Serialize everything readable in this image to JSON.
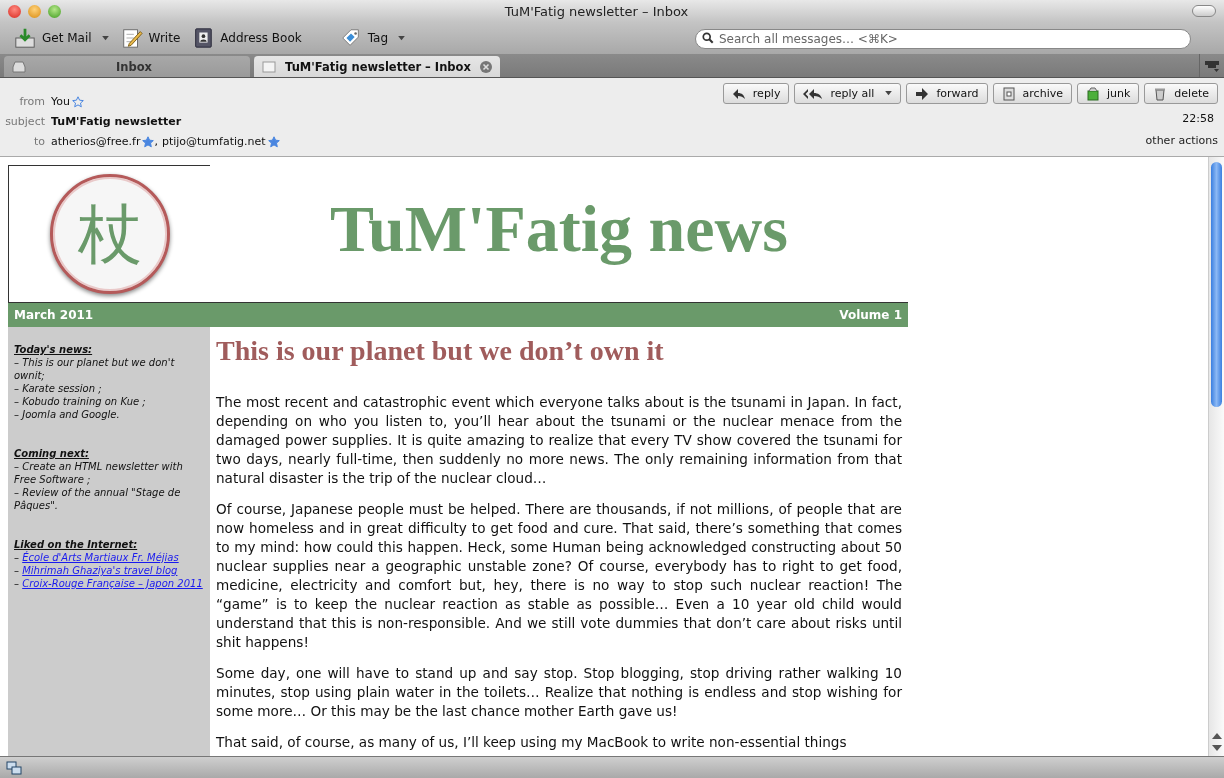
{
  "window": {
    "title": "TuM'Fatig newsletter – Inbox"
  },
  "toolbar": {
    "buttons": [
      {
        "label": "Get Mail",
        "menu": true
      },
      {
        "label": "Write",
        "menu": false
      },
      {
        "label": "Address Book",
        "menu": false
      },
      {
        "label": "Tag",
        "menu": true
      }
    ],
    "search": {
      "placeholder": "Search all messages… <⌘K>"
    }
  },
  "tabs": [
    {
      "label": "Inbox",
      "selected": false,
      "closable": false
    },
    {
      "label": "TuM'Fatig newsletter – Inbox",
      "selected": true,
      "closable": true
    }
  ],
  "header": {
    "from": {
      "label": "from",
      "people": [
        {
          "name": "You",
          "starred": false
        }
      ]
    },
    "subject": {
      "label": "subject",
      "value": "TuM'Fatig newsletter"
    },
    "to": {
      "label": "to",
      "separator": ",",
      "people": [
        {
          "name": "atherios@free.fr",
          "starred": true
        },
        {
          "name": "ptijo@tumfatig.net",
          "starred": true
        }
      ]
    },
    "time": "22:58",
    "other_actions": "other actions",
    "actions": [
      {
        "label": "reply",
        "menu": false
      },
      {
        "label": "reply all",
        "menu": true
      },
      {
        "label": "forward",
        "menu": false
      },
      {
        "label": "archive",
        "menu": false
      },
      {
        "label": "junk",
        "menu": false
      },
      {
        "label": "delete",
        "menu": false
      }
    ]
  },
  "newsletter": {
    "logo": "杖",
    "title": "TuM'Fatig news",
    "date": "March 2011",
    "volume": "Volume 1",
    "sidebar": [
      {
        "heading": "Today's news:",
        "items": [
          {
            "kind": "text",
            "text": "– This is our planet but we don't ownit;"
          },
          {
            "kind": "text",
            "text": "– Karate session ;"
          },
          {
            "kind": "text",
            "text": "– Kobudo training on Kue ;"
          },
          {
            "kind": "text",
            "text": "– Joomla and Google."
          }
        ]
      },
      {
        "heading": "Coming next:",
        "items": [
          {
            "kind": "text",
            "text": "– Create an HTML newsletter with Free Software ;"
          },
          {
            "kind": "text",
            "text": "– Review of the annual \"Stage de Pâques\"."
          }
        ]
      },
      {
        "heading": "Liked on the Internet:",
        "items": [
          {
            "kind": "link",
            "prefix": "– ",
            "text": "École d'Arts Martiaux Fr. Méjias"
          },
          {
            "kind": "link",
            "prefix": "– ",
            "text": "Mihrimah Ghaziya's travel blog"
          },
          {
            "kind": "link",
            "prefix": "– ",
            "text": "Croix-Rouge Française – Japon 2011"
          }
        ]
      }
    ],
    "article_title": "This is our planet but we don’t own it",
    "paragraphs": [
      "The most recent and catastrophic event which everyone talks about is the tsunami in Japan. In fact, depending on who you listen to, you’ll hear about the tsunami or the nuclear menace from the damaged power supplies. It is quite amazing to realize that every TV show covered the tsunami for two days, nearly full-time, then suddenly no more news. The only remaining information from that natural disaster is the trip of the nuclear cloud…",
      "Of course, Japanese people must be helped. There are thousands, if not millions, of people that are now homeless and in great difficulty to get food and cure. That said, there’s something that comes to my mind: how could this happen. Heck, some Human being acknowledged constructing about 50 nuclear supplies near a geographic unstable zone? Of course, everybody has to right to get food, medicine, electricity and comfort but, hey, there is no way to stop such nuclear reaction! The “game” is to keep the nuclear reaction as stable as possible… Even a 10 year old child would understand that this is non-responsible. And we still vote dummies that don’t care about risks until shit happens!",
      "Some day, one will have to stand up and say stop. Stop blogging, stop driving rather walking 10 minutes, stop using plain water in the toilets… Realize that nothing is endless and stop wishing for some more… Or this may be the last chance mother Earth gave us!",
      "That said, of course, as many of us, I’ll keep using my MacBook to write non-essential things"
    ]
  }
}
